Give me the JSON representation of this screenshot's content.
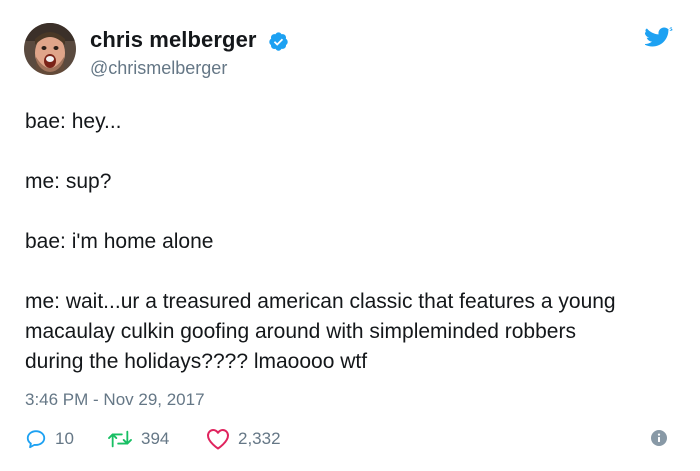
{
  "author": {
    "display_name": "chris melberger",
    "handle": "@chrismelberger",
    "verified": true,
    "avatar_icon": "avatar-photo"
  },
  "brand": {
    "logo_icon": "twitter-bird-icon",
    "accent_color": "#1da1f2"
  },
  "tweet": {
    "lines": [
      "bae: hey...",
      "me: sup?",
      "bae: i'm home alone",
      "me: wait...ur a treasured american classic that features a young",
      "macaulay culkin goofing around with simpleminded robbers",
      "during the holidays???? lmaoooo wtf"
    ],
    "timestamp": "3:46 PM - Nov 29, 2017"
  },
  "actions": {
    "reply_count": "10",
    "retweet_count": "394",
    "like_count": "2,332",
    "reply_icon": "reply-icon",
    "retweet_icon": "retweet-icon",
    "like_icon": "heart-icon",
    "info_icon": "info-icon"
  }
}
